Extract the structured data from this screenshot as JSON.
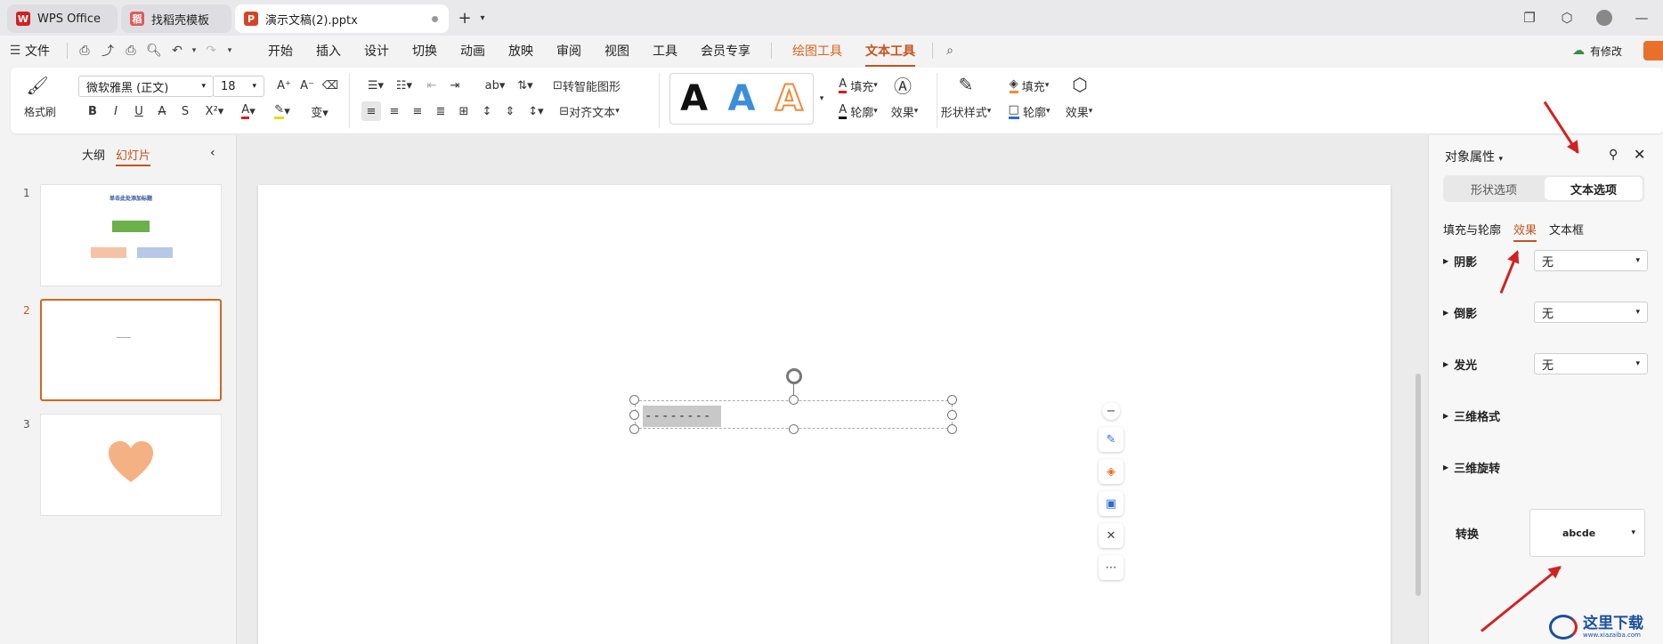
{
  "tabs": [
    {
      "label": "WPS Office",
      "icon": "wps-logo-icon",
      "icon_color": "#d42020"
    },
    {
      "label": "找稻壳模板",
      "icon": "docer-icon",
      "icon_color": "#e05a5a"
    },
    {
      "label": "演示文稿(2).pptx",
      "icon": "ppt-file-icon",
      "icon_color": "#d24726"
    }
  ],
  "menu": {
    "file": "文件",
    "items": [
      "开始",
      "插入",
      "设计",
      "切换",
      "动画",
      "放映",
      "审阅",
      "视图",
      "工具",
      "会员专享"
    ],
    "drawing_tools": "绘图工具",
    "text_tools": "文本工具",
    "modified": "有修改"
  },
  "ribbon": {
    "format_painter": "格式刷",
    "font_name": "微软雅黑 (正文)",
    "font_size": "18",
    "smart_shape": "转智能图形",
    "align_text": "对齐文本",
    "fill1": "填充",
    "outline1": "轮廓",
    "effect1": "效果",
    "shape_style": "形状样式",
    "fill2": "填充",
    "outline2": "轮廓",
    "effect2": "效果",
    "wordart_letter": "A"
  },
  "left_panel": {
    "outline_tab": "大纲",
    "slides_tab": "幻灯片",
    "slides": [
      {
        "num": "1",
        "title": "单击此处添加标题"
      },
      {
        "num": "2"
      },
      {
        "num": "3"
      }
    ]
  },
  "slide": {
    "text_content": "--------"
  },
  "right_panel": {
    "title": "对象属性",
    "shape_options": "形状选项",
    "text_options": "文本选项",
    "sub_fill": "填充与轮廓",
    "sub_effect": "效果",
    "sub_textbox": "文本框",
    "props": [
      {
        "label": "阴影",
        "value": "无"
      },
      {
        "label": "倒影",
        "value": "无"
      },
      {
        "label": "发光",
        "value": "无"
      },
      {
        "label": "三维格式"
      },
      {
        "label": "三维旋转"
      }
    ],
    "transform_label": "转换",
    "transform_value": "abcde"
  },
  "watermark": {
    "text": "这里下载",
    "url": "www.xiazaiba.com"
  },
  "colors": {
    "accent": "#c4541c",
    "arrow": "#d42020"
  }
}
